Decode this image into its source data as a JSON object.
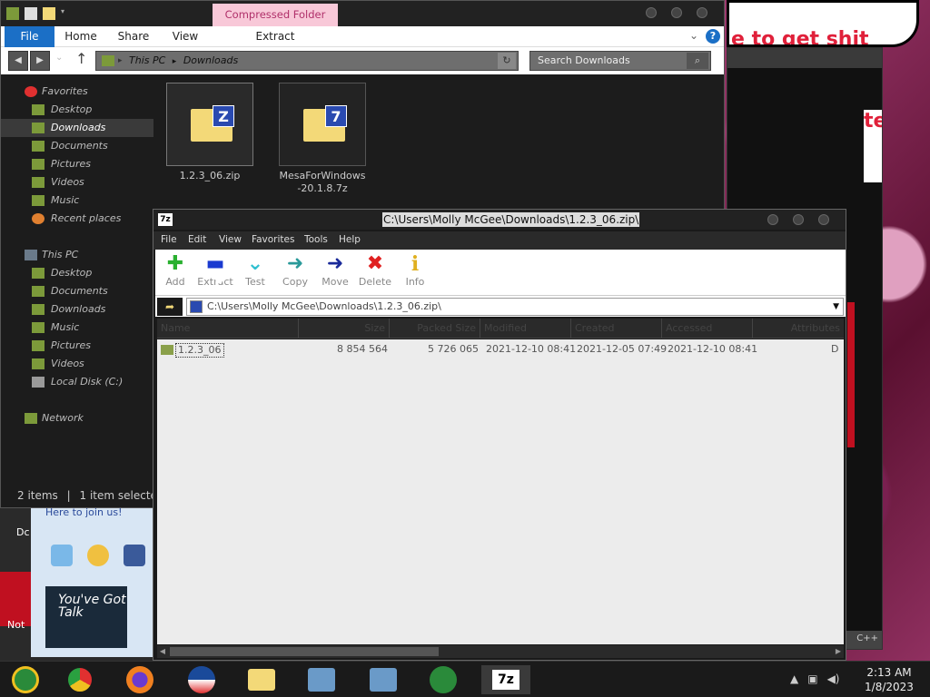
{
  "background": {
    "bubble_text": "e to get shit",
    "browser_fragment": "te",
    "left_panel_join": "Here to join us!",
    "left_panel_tile": "You've Got Talk",
    "left_side_label": "Not",
    "left_side_label2": "Dc",
    "browser_bottom": "C++"
  },
  "explorer": {
    "context_tab": "Compressed Folder Tools",
    "ribbon_tabs": [
      "File",
      "Home",
      "Share",
      "View",
      "Extract"
    ],
    "help_label": "?",
    "address": [
      "This PC",
      "Downloads"
    ],
    "search_placeholder": "Search Downloads",
    "nav_favorites": "Favorites",
    "favorites": [
      "Desktop",
      "Downloads",
      "Documents",
      "Pictures",
      "Videos",
      "Music",
      "Recent places"
    ],
    "nav_thispc": "This PC",
    "thispc": [
      "Desktop",
      "Documents",
      "Downloads",
      "Music",
      "Pictures",
      "Videos",
      "Local Disk (C:)"
    ],
    "nav_network": "Network",
    "files": [
      {
        "name": "1.2.3_06.zip",
        "badge": "Z"
      },
      {
        "name": "MesaForWindows-20.1.8.7z",
        "badge": "7"
      }
    ],
    "status_items": "2 items",
    "status_selected": "1 item selected"
  },
  "sevenzip": {
    "logo": "7z",
    "title_path": "C:\\Users\\Molly McGee\\Downloads\\1.2.3_06.zip\\",
    "menu": [
      "File",
      "Edit",
      "View",
      "Favorites",
      "Tools",
      "Help"
    ],
    "tools": [
      {
        "label": "Add",
        "glyph": "✚",
        "color": "#2ab030"
      },
      {
        "label": "Extract",
        "glyph": "▬",
        "color": "#1a3ad0"
      },
      {
        "label": "Test",
        "glyph": "⌄",
        "color": "#30c0d0"
      },
      {
        "label": "Copy",
        "glyph": "➜",
        "color": "#2a9a9a"
      },
      {
        "label": "Move",
        "glyph": "➜",
        "color": "#1a2a9a"
      },
      {
        "label": "Delete",
        "glyph": "✖",
        "color": "#e02020"
      },
      {
        "label": "Info",
        "glyph": "i",
        "color": "#e0b020"
      }
    ],
    "address": "C:\\Users\\Molly McGee\\Downloads\\1.2.3_06.zip\\",
    "columns": [
      "Name",
      "Size",
      "Packed Size",
      "Modified",
      "Created",
      "Accessed",
      "Attributes"
    ],
    "rows": [
      {
        "name": "1.2.3_06",
        "size": "8 854 564",
        "packed": "5 726 065",
        "modified": "2021-12-10 08:41",
        "created": "2021-12-05 07:49",
        "accessed": "2021-12-10 08:41",
        "attr": "D"
      }
    ]
  },
  "taskbar": {
    "apps": [
      "media-center",
      "chrome",
      "firefox",
      "obama",
      "file-explorer",
      "network-1",
      "network-2",
      "people",
      "7zip"
    ],
    "active_label": "7z",
    "time": "2:13 AM",
    "date": "1/8/2023"
  }
}
